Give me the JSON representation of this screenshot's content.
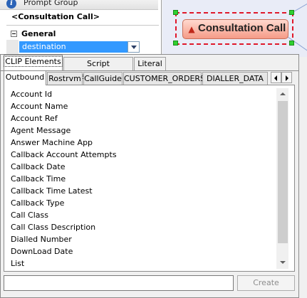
{
  "property_panel": {
    "prompt_group_label": "Prompt Group",
    "node_name": "<Consultation Call>",
    "section_label": "General",
    "selected_property": "destination"
  },
  "canvas": {
    "node_label": "Consultation Call",
    "colors": {
      "selection_border": "#e0182a",
      "handle": "#2fd12f",
      "node_fill": "#f59b87"
    }
  },
  "popup": {
    "top_tabs": [
      "CLIP Elements",
      "Script Parameters",
      "Literal"
    ],
    "sub_tabs": [
      "Outbound",
      "Rostrvm",
      "CallGuide",
      "CUSTOMER_ORDERS",
      "DIALLER_DATA"
    ],
    "items": [
      "Account Id",
      "Account Name",
      "Account Ref",
      "Agent Message",
      "Answer Machine App",
      "Callback Account Attempts",
      "Callback Date",
      "Callback Time",
      "Callback Time Latest",
      "Callback Type",
      "Call Class",
      "Call Class Description",
      "Dialled Number",
      "DownLoad Date",
      "List"
    ],
    "name_input": {
      "value": "",
      "placeholder": ""
    },
    "create_label": "Create"
  }
}
